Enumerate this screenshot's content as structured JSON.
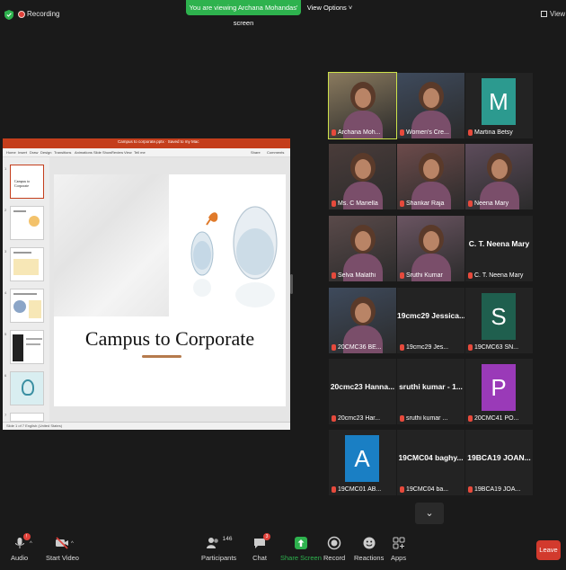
{
  "top": {
    "recording_label": "Recording",
    "viewing_banner": "You are viewing Archana Mohandas' screen",
    "view_options": "View Options ˅",
    "view_label": "View"
  },
  "presentation": {
    "window_title": "Campus to corporate.pptx  ·  Saved to my Mac",
    "tabs": [
      "Home",
      "Insert",
      "Draw",
      "Design",
      "Transitions",
      "Animations",
      "Slide Show",
      "Review",
      "View",
      "Tell me"
    ],
    "share_label": "Share",
    "comments_label": "Comments",
    "slide_title": "Campus to Corporate",
    "status_text": "Slide 1 of 7    English (United States)",
    "thumbnail_numbers": [
      "1",
      "2",
      "3",
      "4",
      "5",
      "6",
      "7"
    ]
  },
  "participants": [
    {
      "name": "Archana Moh...",
      "kind": "video",
      "active": true
    },
    {
      "name": "Women's Cre...",
      "kind": "video"
    },
    {
      "name": "Martina Betsy",
      "kind": "avatar",
      "letter": "M",
      "color": "#2c9a8f"
    },
    {
      "name": "Ms. C Mariella",
      "kind": "video"
    },
    {
      "name": "Shankar Raja",
      "kind": "video"
    },
    {
      "name": "Neena Mary",
      "kind": "video"
    },
    {
      "name": "Selva Malathi",
      "kind": "video"
    },
    {
      "name": "Sruthi Kumar",
      "kind": "video"
    },
    {
      "name": "C. T. Neena Mary",
      "kind": "text",
      "big": "C. T. Neena Mary"
    },
    {
      "name": "20CMC36 BE...",
      "kind": "video"
    },
    {
      "name": "19cmc29 Jes...",
      "kind": "text",
      "big": "19cmc29 Jessica..."
    },
    {
      "name": "19CMC63 SN...",
      "kind": "avatar",
      "letter": "S",
      "color": "#1f5f4e"
    },
    {
      "name": "20cmc23 Har...",
      "kind": "text",
      "big": "20cmc23 Hanna..."
    },
    {
      "name": "sruthi kumar ...",
      "kind": "text",
      "big": "sruthi kumar - 1..."
    },
    {
      "name": "20CMC41 PO...",
      "kind": "avatar",
      "letter": "P",
      "color": "#9a3ab8"
    },
    {
      "name": "19CMC01 AB...",
      "kind": "avatar",
      "letter": "A",
      "color": "#1a7fc4"
    },
    {
      "name": "19CMC04 ba...",
      "kind": "text",
      "big": "19CMC04 baghy..."
    },
    {
      "name": "19BCA19 JOA...",
      "kind": "text",
      "big": "19BCA19 JOAN..."
    }
  ],
  "toolbar": {
    "audio": "Audio",
    "start_video": "Start Video",
    "participants": "Participants",
    "participants_count": "146",
    "chat": "Chat",
    "chat_badge": "3",
    "share_screen": "Share Screen",
    "record": "Record",
    "reactions": "Reactions",
    "apps": "Apps",
    "leave": "Leave",
    "share_color": "#2eb24e"
  }
}
